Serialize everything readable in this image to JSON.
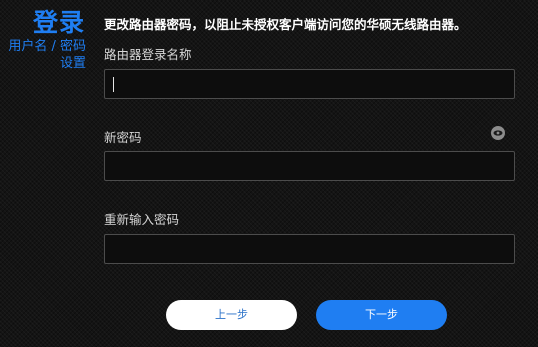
{
  "sidebar": {
    "title": "登录",
    "subtitle_line1": "用户名 / 密码",
    "subtitle_line2": "设置"
  },
  "main": {
    "description": "更改路由器密码，以阻止未授权客户端访问您的华硕无线路由器。",
    "fields": [
      {
        "label": "路由器登录名称",
        "value": ""
      },
      {
        "label": "新密码",
        "value": ""
      },
      {
        "label": "重新输入密码",
        "value": ""
      }
    ]
  },
  "buttons": {
    "prev": "上一步",
    "next": "下一步"
  },
  "colors": {
    "accent": "#1f7ef2",
    "background": "#141414"
  },
  "icons": {
    "password_toggle": "eye-icon"
  }
}
